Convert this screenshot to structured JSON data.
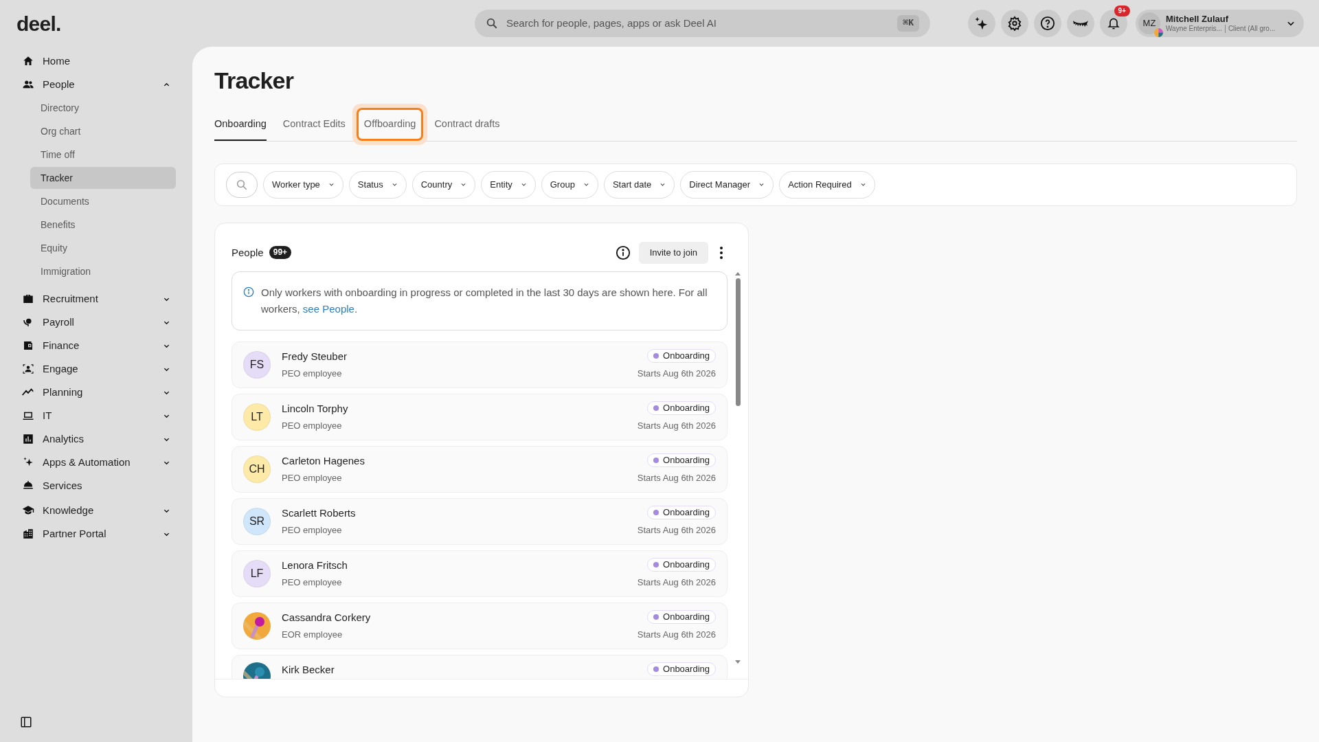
{
  "topbar": {
    "logo": "deel.",
    "search": {
      "placeholder": "Search for people, pages, apps or ask Deel AI",
      "shortcut": "⌘K"
    },
    "notification_badge": "9+",
    "user": {
      "initials": "MZ",
      "name": "Mitchell Zulauf",
      "org": "Wayne Enterpris...",
      "role": "Client (All gro..."
    }
  },
  "sidebar": {
    "items": [
      {
        "label": "Home"
      },
      {
        "label": "People",
        "expanded": true,
        "children": [
          {
            "label": "Directory",
            "selected": false
          },
          {
            "label": "Org chart",
            "selected": false
          },
          {
            "label": "Time off",
            "selected": false
          },
          {
            "label": "Tracker",
            "selected": true
          },
          {
            "label": "Documents",
            "selected": false
          },
          {
            "label": "Benefits",
            "selected": false
          },
          {
            "label": "Equity",
            "selected": false
          },
          {
            "label": "Immigration",
            "selected": false
          }
        ]
      },
      {
        "label": "Recruitment",
        "expanded": false
      },
      {
        "label": "Payroll",
        "expanded": false
      },
      {
        "label": "Finance",
        "expanded": false
      },
      {
        "label": "Engage",
        "expanded": false
      },
      {
        "label": "Planning",
        "expanded": false
      },
      {
        "label": "IT",
        "expanded": false
      },
      {
        "label": "Analytics",
        "expanded": false
      },
      {
        "label": "Apps & Automation",
        "expanded": false
      },
      {
        "label": "Services"
      },
      {
        "label": "Knowledge",
        "expanded": false
      },
      {
        "label": "Partner Portal",
        "expanded": false
      }
    ]
  },
  "page": {
    "title": "Tracker",
    "tabs": [
      {
        "label": "Onboarding",
        "selected": true,
        "highlighted": false
      },
      {
        "label": "Contract Edits",
        "selected": false,
        "highlighted": false
      },
      {
        "label": "Offboarding",
        "selected": false,
        "highlighted": true
      },
      {
        "label": "Contract drafts",
        "selected": false,
        "highlighted": false
      }
    ],
    "filters": [
      "Worker type",
      "Status",
      "Country",
      "Entity",
      "Group",
      "Start date",
      "Direct Manager",
      "Action Required"
    ],
    "people_card": {
      "title": "People",
      "count": "99+",
      "invite_button": "Invite to join",
      "notice": {
        "text": "Only workers with onboarding in progress or completed in the last 30 days are shown here. For all workers, ",
        "link": "see People",
        "after": "."
      },
      "rows": [
        {
          "avatar": {
            "kind": "initials",
            "initials": "FS",
            "color": "#e5dcf7"
          },
          "name": "Fredy Steuber",
          "type": "PEO employee",
          "status": "Onboarding",
          "start": "Starts Aug 6th 2026"
        },
        {
          "avatar": {
            "kind": "initials",
            "initials": "LT",
            "color": "#fde9a8"
          },
          "name": "Lincoln Torphy",
          "type": "PEO employee",
          "status": "Onboarding",
          "start": "Starts Aug 6th 2026"
        },
        {
          "avatar": {
            "kind": "initials",
            "initials": "CH",
            "color": "#fde9a8"
          },
          "name": "Carleton Hagenes",
          "type": "PEO employee",
          "status": "Onboarding",
          "start": "Starts Aug 6th 2026"
        },
        {
          "avatar": {
            "kind": "initials",
            "initials": "SR",
            "color": "#cfe6fb"
          },
          "name": "Scarlett Roberts",
          "type": "PEO employee",
          "status": "Onboarding",
          "start": "Starts Aug 6th 2026"
        },
        {
          "avatar": {
            "kind": "initials",
            "initials": "LF",
            "color": "#e5dcf7"
          },
          "name": "Lenora Fritsch",
          "type": "PEO employee",
          "status": "Onboarding",
          "start": "Starts Aug 6th 2026"
        },
        {
          "name": "Cassandra Corkery",
          "type": "EOR employee",
          "status": "Onboarding",
          "start": "Starts Aug 6th 2026"
        },
        {
          "name": "Kirk Becker",
          "status": "Onboarding"
        }
      ]
    }
  }
}
